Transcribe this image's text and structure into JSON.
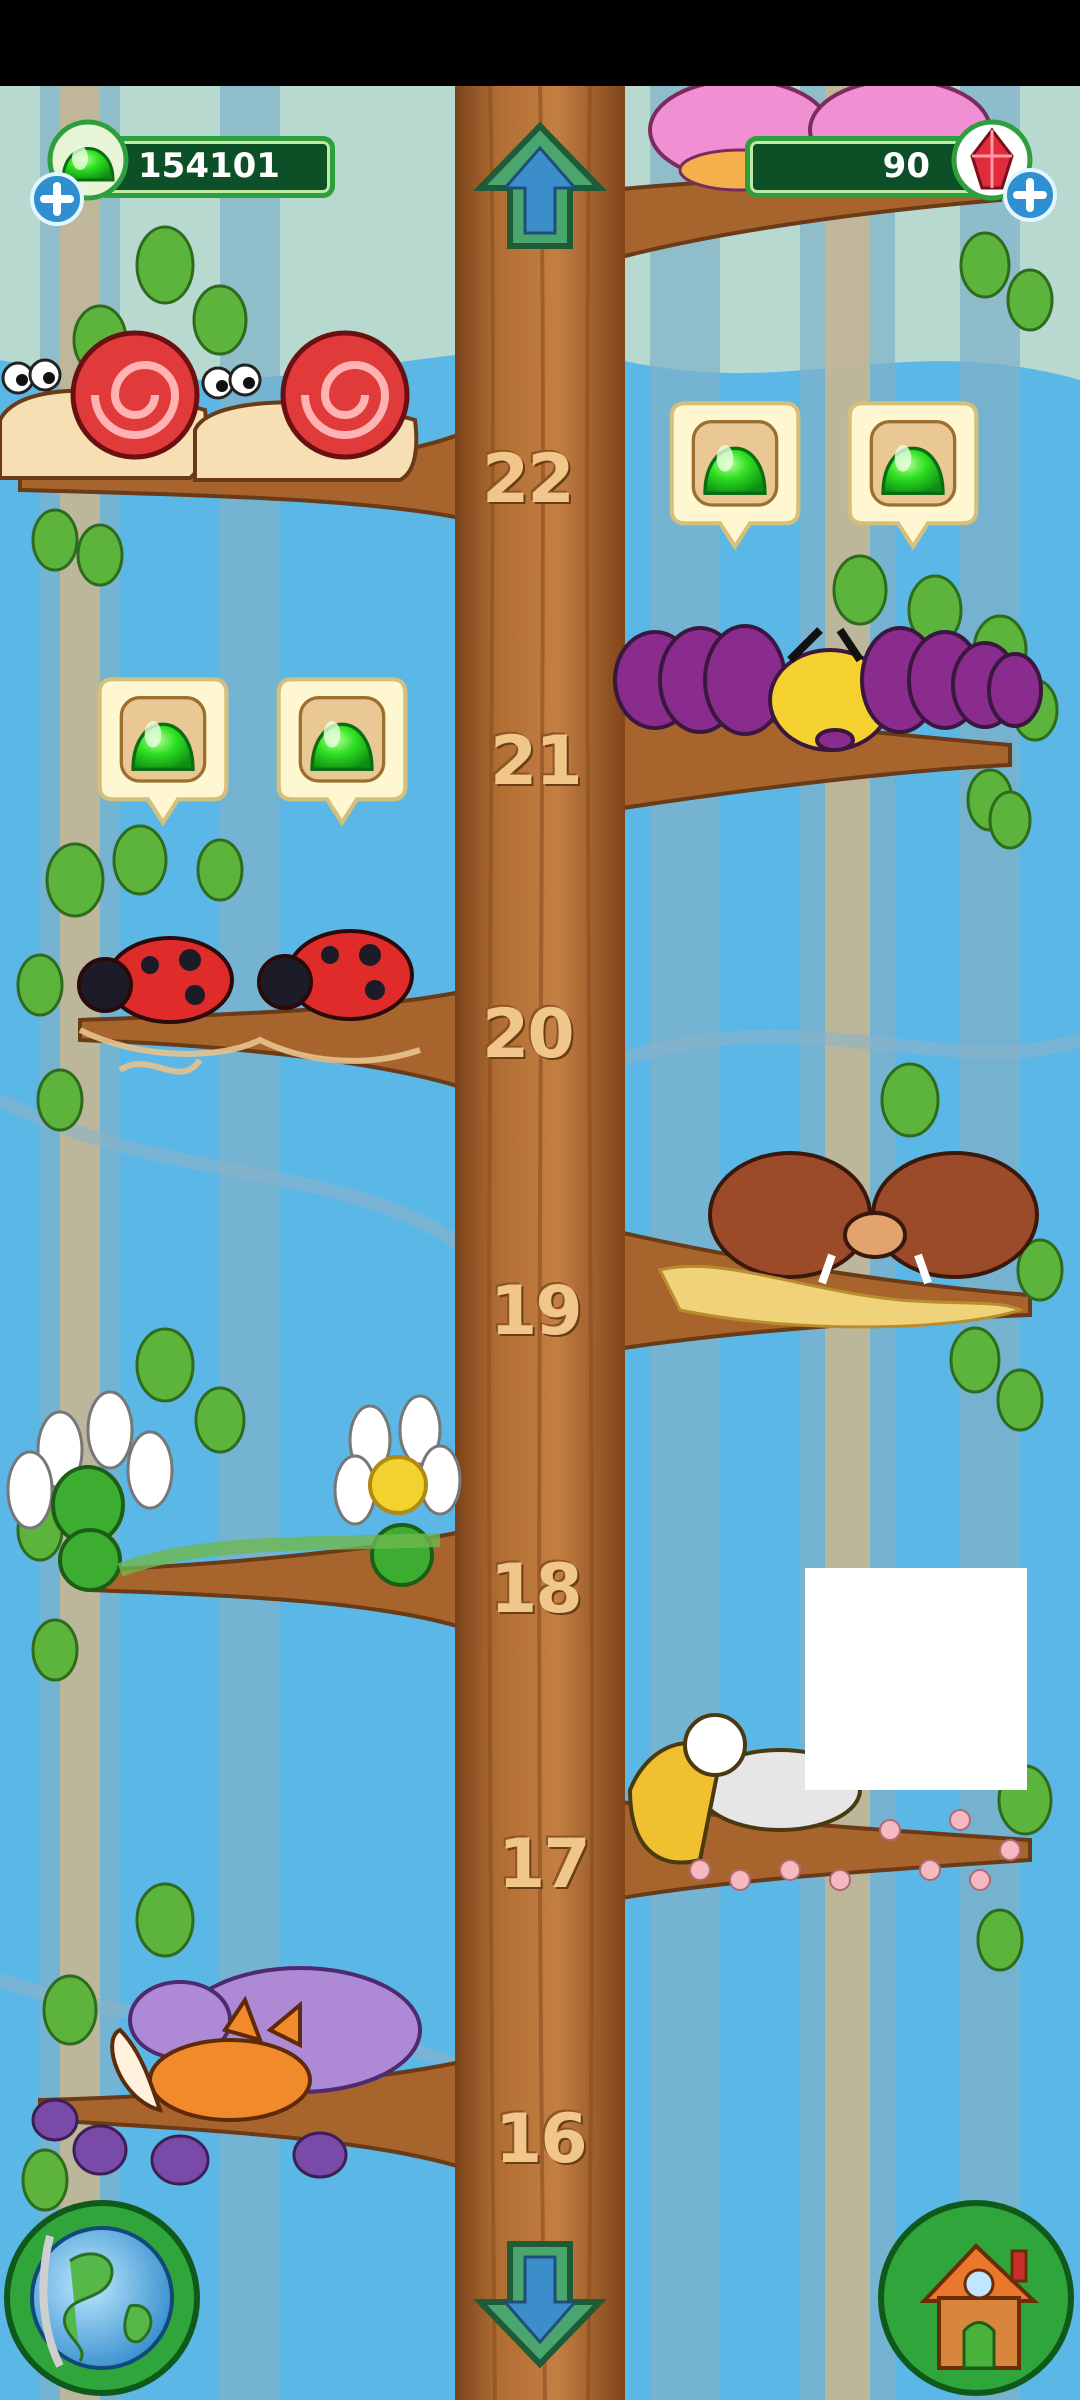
{
  "hud": {
    "jelly_count": "154101",
    "gem_count": "90",
    "jelly_icon": "green-jelly-icon",
    "gem_icon": "red-crystal-icon",
    "add_icon": "plus-icon"
  },
  "tree": {
    "levels": [
      "22",
      "21",
      "20",
      "19",
      "18",
      "17",
      "16"
    ]
  },
  "navigation": {
    "up_icon": "arrow-up-icon",
    "down_icon": "arrow-down-icon",
    "world_icon": "globe-icon",
    "home_icon": "house-icon"
  },
  "colors": {
    "sky": "#5bb7e6",
    "trunk": "#a8642d",
    "leaf": "#5cb43c",
    "jelly": "#22d21c",
    "hud_bg": "#0d4f27"
  }
}
